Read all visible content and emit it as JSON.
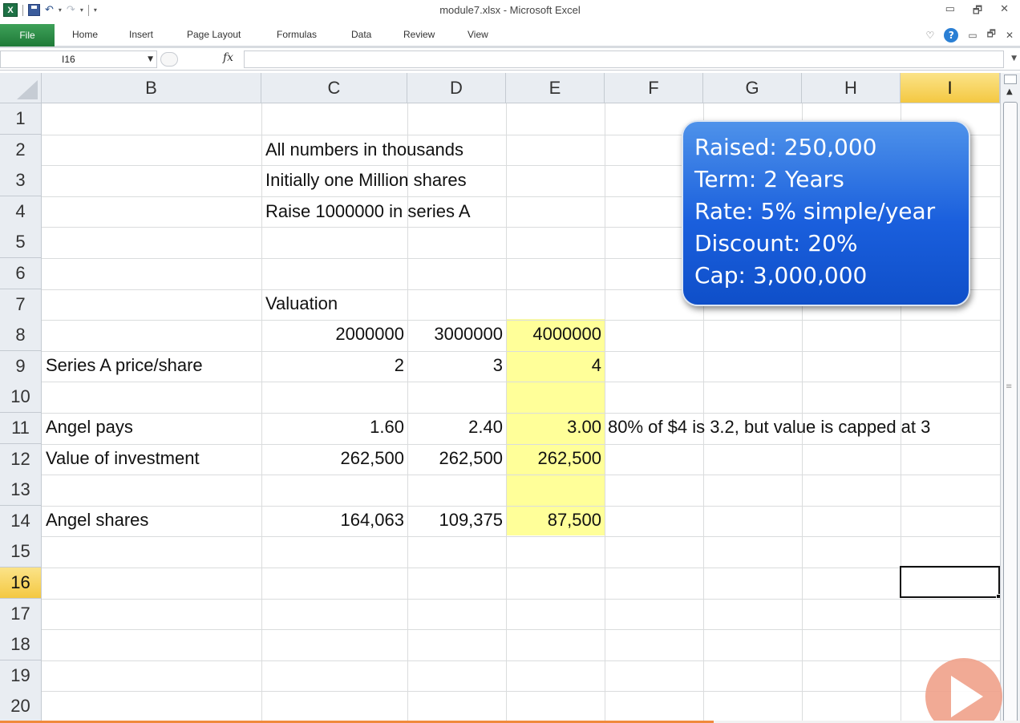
{
  "window": {
    "title": "module7.xlsx - Microsoft Excel",
    "logo": "X",
    "controls": [
      "▭",
      "🗗",
      "✕"
    ]
  },
  "ribbon": {
    "file_tab": "File",
    "tabs": [
      "Home",
      "Insert",
      "Page Layout",
      "Formulas",
      "Data",
      "Review",
      "View"
    ],
    "help": "?"
  },
  "formula_bar": {
    "name_box": "I16",
    "fx": "fx",
    "formula": ""
  },
  "grid": {
    "columns": [
      "B",
      "C",
      "D",
      "E",
      "F",
      "G",
      "H",
      "I"
    ],
    "selected_column": "I",
    "rows": [
      "1",
      "2",
      "3",
      "4",
      "5",
      "6",
      "7",
      "8",
      "9",
      "10",
      "11",
      "12",
      "13",
      "14",
      "15",
      "16",
      "17",
      "18",
      "19",
      "20"
    ],
    "selected_row": "16",
    "cells": {
      "C2": "All numbers in thousands",
      "C3": "Initially one Million shares",
      "C4": "Raise 1000000 in series A",
      "C7": "Valuation",
      "C8": "2000000",
      "D8": "3000000",
      "E8": "4000000",
      "B9": "Series A price/share",
      "C9": "2",
      "D9": "3",
      "E9": "4",
      "B11": "Angel pays",
      "C11": "1.60",
      "D11": "2.40",
      "E11": "3.00",
      "F11": "80% of $4 is 3.2, but value is capped at 3",
      "B12": "Value of investment",
      "C12": "262,500",
      "D12": "262,500",
      "E12": "262,500",
      "B14": "Angel shares",
      "C14": "164,063",
      "D14": "109,375",
      "E14": "87,500"
    },
    "highlight_color": "#ffff99",
    "active_cell": "I16"
  },
  "callout": {
    "lines": [
      "Raised: 250,000",
      "Term: 2 Years",
      "Rate: 5% simple/year",
      "Discount: 20%",
      "Cap: 3,000,000"
    ]
  },
  "colors": {
    "file_tab": "#23833f",
    "selected_header": "#f4c842",
    "callout": "#1a5fdd",
    "progress": "#f08a3c"
  },
  "video": {
    "progress": 0.7
  }
}
